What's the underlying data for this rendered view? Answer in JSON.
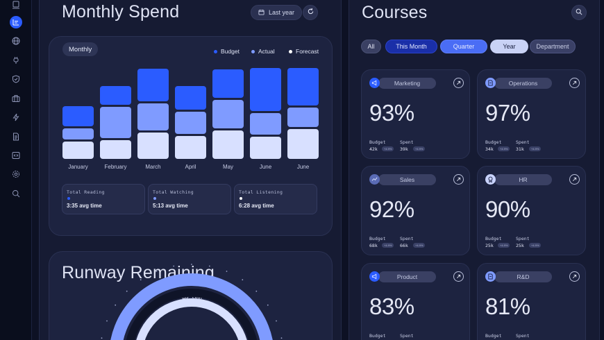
{
  "monthly": {
    "title": "Monthly Spend",
    "period_label": "Last year",
    "chart_tag": "Monthly",
    "legend": [
      {
        "label": "Budget",
        "color": "#2b5cff"
      },
      {
        "label": "Actual",
        "color": "#7f9bff"
      },
      {
        "label": "Forecast",
        "color": "#d8e0ff"
      }
    ],
    "stats": [
      {
        "label": "Total Reading",
        "value": "3:35 avg time",
        "color": "#2b5cff"
      },
      {
        "label": "Total Watching",
        "value": "5:13 avg time",
        "color": "#7f9bff"
      },
      {
        "label": "Total Listening",
        "value": "6:28 avg time",
        "color": "#ffffff"
      }
    ]
  },
  "chart_data": {
    "type": "bar",
    "stacked": true,
    "categories": [
      "January",
      "February",
      "March",
      "April",
      "May",
      "June",
      "June"
    ],
    "series": [
      {
        "name": "Budget",
        "values": [
          30,
          28,
          50,
          35,
          43,
          65,
          57
        ],
        "color": "#2b5cff"
      },
      {
        "name": "Actual",
        "values": [
          17,
          47,
          40,
          34,
          43,
          33,
          29
        ],
        "color": "#7f9bff"
      },
      {
        "name": "Forecast",
        "values": [
          26,
          28,
          40,
          34,
          43,
          33,
          45
        ],
        "color": "#d8e0ff"
      }
    ],
    "ylim": [
      0,
      140
    ],
    "grid": false,
    "legend_position": "top-right"
  },
  "runway": {
    "title": "Runway Remaining",
    "value": "$2.6M"
  },
  "courses": {
    "title": "Courses",
    "filters": [
      {
        "label": "All",
        "state": "muted"
      },
      {
        "label": "This Month",
        "state": "active-dark"
      },
      {
        "label": "Quarter",
        "state": "active-blue"
      },
      {
        "label": "Year",
        "state": "selected"
      },
      {
        "label": "Department",
        "state": "idle"
      }
    ],
    "metric_labels": {
      "budget": "Budget",
      "spent": "Spent"
    },
    "items": [
      {
        "name": "Marketing",
        "percent": "93%",
        "budget": "42k",
        "spent": "39k",
        "chip": "+4.9%",
        "icon": "megaphone-icon",
        "icon_color": "#2b5cff"
      },
      {
        "name": "Operations",
        "percent": "97%",
        "budget": "34k",
        "spent": "31k",
        "chip": "+4.9%",
        "icon": "document-icon",
        "icon_color": "#7f9bff"
      },
      {
        "name": "Sales",
        "percent": "92%",
        "budget": "68k",
        "spent": "66k",
        "chip": "+4.9%",
        "icon": "trend-icon",
        "icon_color": "#5a6bb5"
      },
      {
        "name": "HR",
        "percent": "90%",
        "budget": "25k",
        "spent": "25k",
        "chip": "+4.9%",
        "icon": "badge-icon",
        "icon_color": "#c9d3ff"
      },
      {
        "name": "Product",
        "percent": "83%",
        "budget": "",
        "spent": "",
        "chip": "",
        "icon": "megaphone-icon",
        "icon_color": "#2b5cff"
      },
      {
        "name": "R&D",
        "percent": "81%",
        "budget": "",
        "spent": "",
        "chip": "",
        "icon": "document-icon",
        "icon_color": "#7f9bff"
      }
    ]
  },
  "sidebar": {
    "items": [
      "laptop-icon",
      "chart-icon",
      "globe-icon",
      "plug-icon",
      "shield-icon",
      "briefcase-icon",
      "bolt-icon",
      "file-icon",
      "code-icon",
      "settings-icon",
      "search-icon"
    ]
  }
}
